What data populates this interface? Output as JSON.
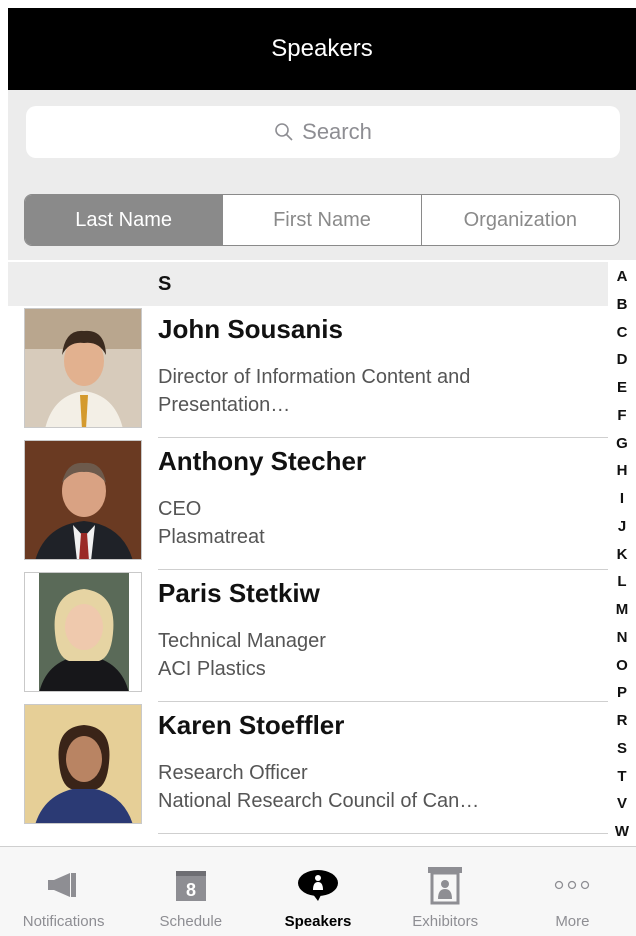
{
  "header": {
    "title": "Speakers"
  },
  "search": {
    "placeholder": "Search"
  },
  "sort_options": [
    {
      "label": "Last Name",
      "active": true
    },
    {
      "label": "First Name",
      "active": false
    },
    {
      "label": "Organization",
      "active": false
    }
  ],
  "section": {
    "letter": "S"
  },
  "speakers": [
    {
      "name": "John Sousanis",
      "line1": "Director of Information Content and",
      "line2": "Presentation…",
      "avatar": "portrait-photo"
    },
    {
      "name": "Anthony Stecher",
      "line1": "CEO",
      "line2": "Plasmatreat",
      "avatar": "portrait-photo"
    },
    {
      "name": "Paris Stetkiw",
      "line1": "Technical Manager",
      "line2": "ACI Plastics",
      "avatar": "portrait-photo"
    },
    {
      "name": "Karen Stoeffler",
      "line1": "Research Officer",
      "line2": "National Research Council of Can…",
      "avatar": "portrait-photo"
    }
  ],
  "index_letters": [
    "A",
    "B",
    "C",
    "D",
    "E",
    "F",
    "G",
    "H",
    "I",
    "J",
    "K",
    "L",
    "M",
    "N",
    "O",
    "P",
    "R",
    "S",
    "T",
    "V",
    "W"
  ],
  "tabs": [
    {
      "label": "Notifications",
      "icon": "megaphone-icon",
      "active": false
    },
    {
      "label": "Schedule",
      "icon": "calendar-icon",
      "badge": "8",
      "active": false
    },
    {
      "label": "Speakers",
      "icon": "speech-bubble-person-icon",
      "active": true
    },
    {
      "label": "Exhibitors",
      "icon": "booth-icon",
      "active": false
    },
    {
      "label": "More",
      "icon": "more-dots-icon",
      "active": false
    }
  ],
  "colors": {
    "header_bg": "#000000",
    "segment_active": "#8a8a8a",
    "tab_inactive": "#8e8e93"
  }
}
